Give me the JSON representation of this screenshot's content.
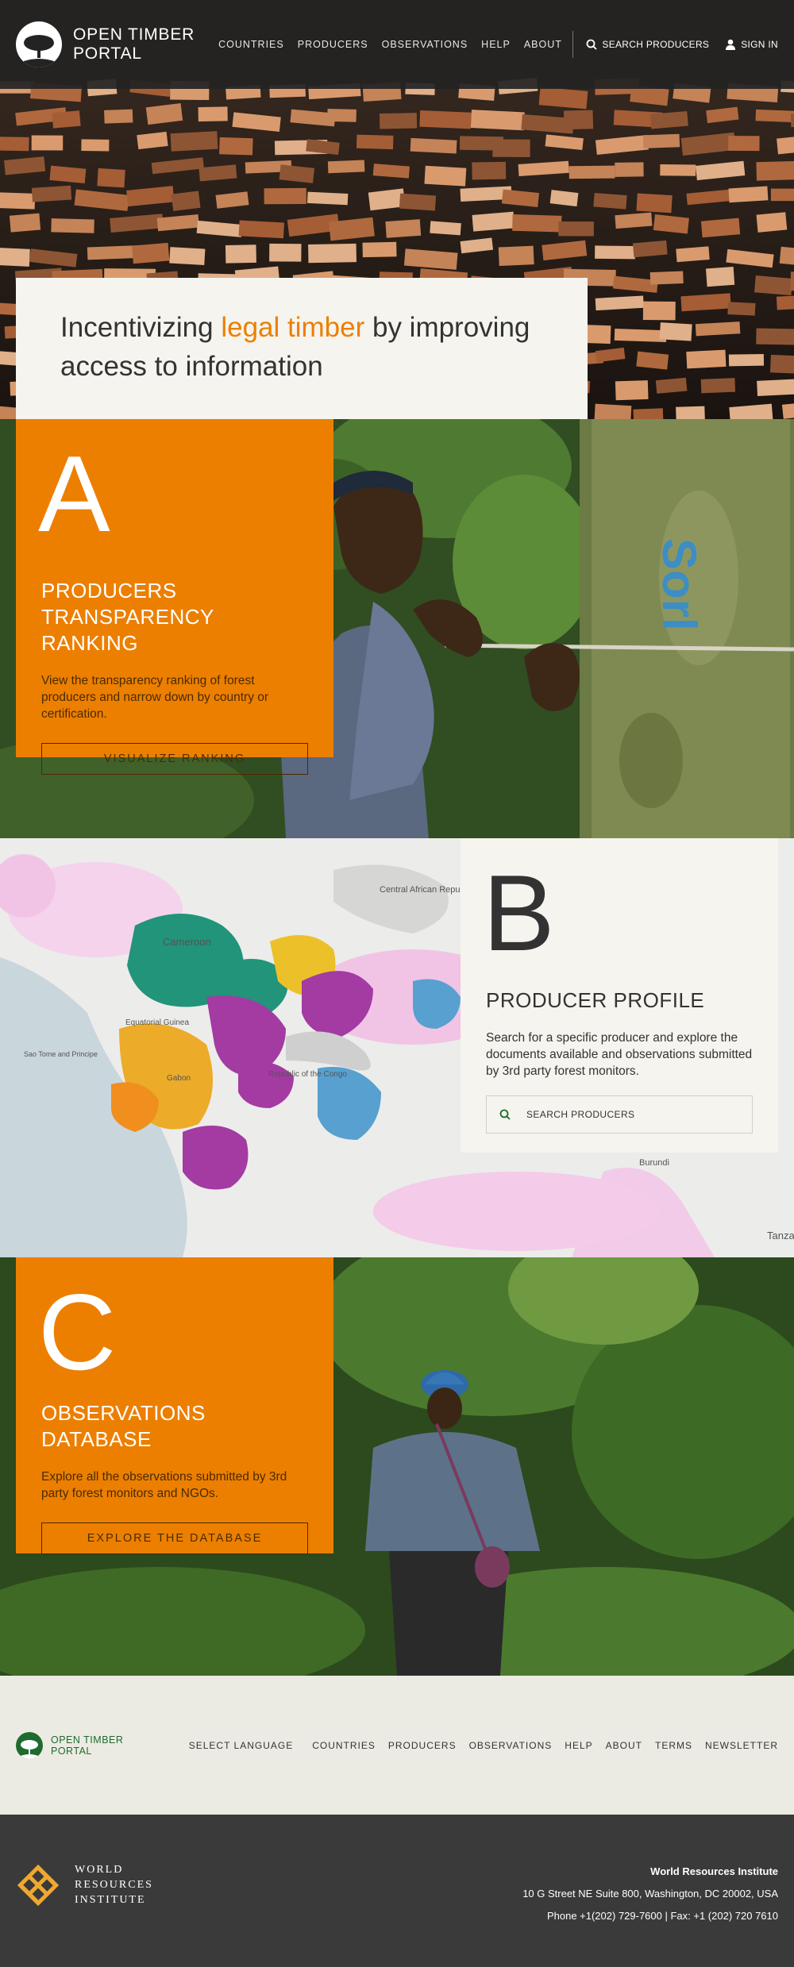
{
  "header": {
    "logo_line1": "OPEN TIMBER",
    "logo_line2": "PORTAL",
    "nav": [
      "COUNTRIES",
      "PRODUCERS",
      "OBSERVATIONS",
      "HELP",
      "ABOUT"
    ],
    "search_label": "SEARCH PRODUCERS",
    "signin_label": "SIGN IN"
  },
  "hero": {
    "title_pre": "Incentivizing ",
    "title_highlight": "legal timber",
    "title_post": " by improving access to information"
  },
  "section_a": {
    "letter": "A",
    "title_line1": "PRODUCERS",
    "title_line2": "TRANSPARENCY RANKING",
    "description": "View the transparency ranking of forest producers and narrow down by country or certification.",
    "button": "VISUALIZE RANKING"
  },
  "section_b": {
    "letter": "B",
    "title": "PRODUCER PROFILE",
    "description": "Search for a specific producer and explore the documents available and observations submitted by 3rd party forest monitors.",
    "search_placeholder": "SEARCH PRODUCERS"
  },
  "section_c": {
    "letter": "C",
    "title": "OBSERVATIONS DATABASE",
    "description": "Explore all the observations submitted by 3rd party forest monitors and NGOs.",
    "button": "EXPLORE THE DATABASE"
  },
  "map_labels": {
    "cameroon": "Cameroon",
    "car": "Central African Republic",
    "equatorial_guinea": "Equatorial Guinea",
    "sao_tome": "Sao Tome and Principe",
    "gabon": "Gabon",
    "congo": "Republic of the Congo",
    "burundi": "Burundi",
    "tanzania": "Tanza"
  },
  "footer": {
    "logo_line1": "OPEN TIMBER",
    "logo_line2": "PORTAL",
    "select_language": "SELECT LANGUAGE",
    "links": [
      "COUNTRIES",
      "PRODUCERS",
      "OBSERVATIONS",
      "HELP",
      "ABOUT",
      "TERMS",
      "NEWSLETTER"
    ]
  },
  "wri": {
    "name_line1": "WORLD",
    "name_line2": "RESOURCES",
    "name_line3": "INSTITUTE",
    "org": "World Resources Institute",
    "address": "10 G Street NE Suite 800, Washington, DC 20002, USA",
    "phone": "Phone +1(202) 729-7600 | Fax: +1 (202) 720 7610"
  },
  "colors": {
    "accent": "#ec7f00",
    "header_bg": "#232323",
    "cream": "#f5f4ee",
    "footer_green": "#1e6b2e",
    "wri_gold": "#f0a830",
    "wri_bg": "#3a3a3a"
  }
}
